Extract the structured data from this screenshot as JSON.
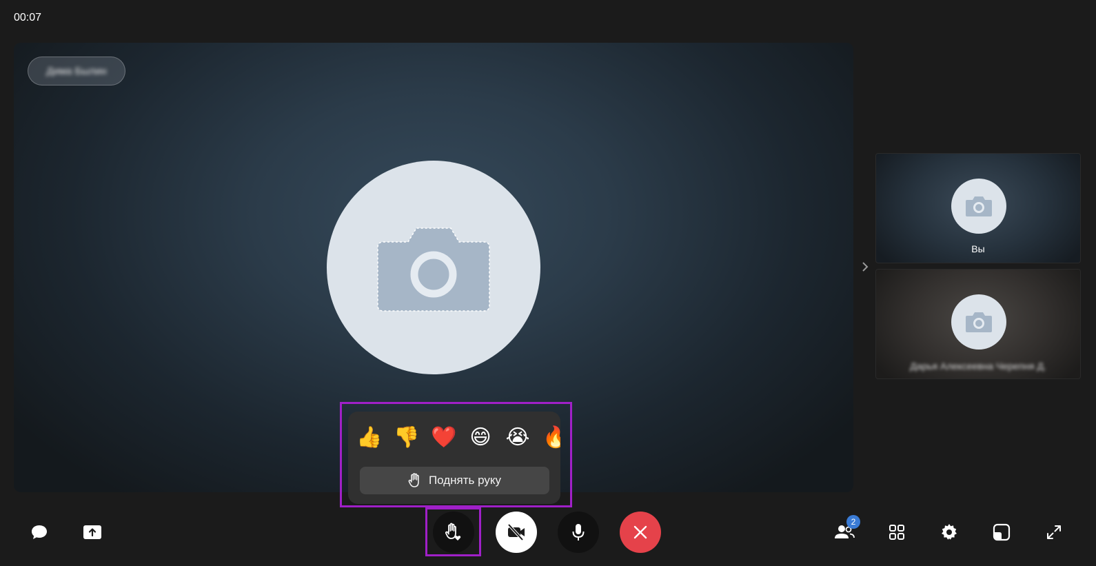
{
  "call": {
    "timer": "00:07"
  },
  "main_video": {
    "speaker_name": "Дима Былин"
  },
  "participants": [
    {
      "label": "Вы"
    },
    {
      "label": "Дарья Алексеевна Черепня Д."
    }
  ],
  "reactions_panel": {
    "emojis": [
      "👍",
      "👎",
      "❤️",
      "😄",
      "😭",
      "🔥"
    ],
    "raise_hand_label": "Поднять руку"
  },
  "toolbar": {
    "participants_count": "2"
  },
  "colors": {
    "background": "#1b1b1b",
    "hangup": "#e5424a",
    "highlight": "#a020c8",
    "badge": "#3a7bd5"
  },
  "icons": {
    "chat": "chat-icon",
    "share_screen": "share-screen-icon",
    "reactions": "reactions-hand-icon",
    "camera_off": "camera-off-icon",
    "microphone": "microphone-icon",
    "hangup": "close-icon",
    "participants": "participants-icon",
    "layout": "grid-layout-icon",
    "settings": "gear-icon",
    "picture_in_picture": "picture-in-picture-icon",
    "fullscreen": "fullscreen-icon"
  }
}
